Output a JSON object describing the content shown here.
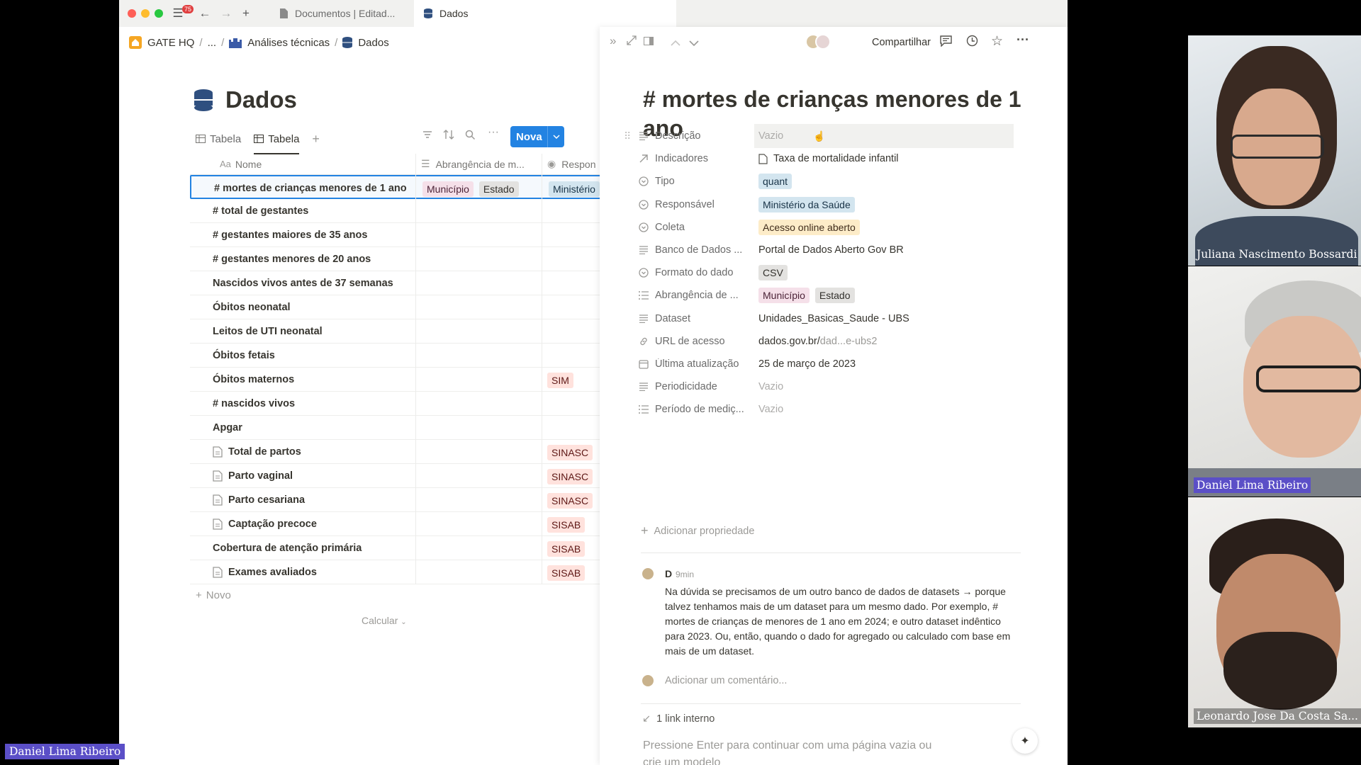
{
  "browser": {
    "badge": "75",
    "tabs": [
      {
        "label": "Documentos | Editad..."
      },
      {
        "label": "Dados"
      }
    ]
  },
  "breadcrumb": [
    "GATE HQ",
    "...",
    "Análises técnicas",
    "Dados"
  ],
  "database": {
    "title": "Dados",
    "views": [
      "Tabela",
      "Tabela"
    ],
    "new_button": "Nova",
    "columns": [
      "Nome",
      "Abrangência de m...",
      "Respon"
    ],
    "rows": [
      {
        "name": "# mortes de crianças menores de 1 ano",
        "doc": false,
        "abr": [
          "Município",
          "Estado"
        ],
        "resp": "Ministério"
      },
      {
        "name": "# total de gestantes",
        "doc": false,
        "abr": [],
        "resp": ""
      },
      {
        "name": "# gestantes maiores de 35 anos",
        "doc": false,
        "abr": [],
        "resp": ""
      },
      {
        "name": "# gestantes menores de 20 anos",
        "doc": false,
        "abr": [],
        "resp": ""
      },
      {
        "name": "Nascidos vivos antes de 37 semanas",
        "doc": false,
        "abr": [],
        "resp": ""
      },
      {
        "name": "Óbitos neonatal",
        "doc": false,
        "abr": [],
        "resp": ""
      },
      {
        "name": "Leitos de UTI neonatal",
        "doc": false,
        "abr": [],
        "resp": ""
      },
      {
        "name": "Óbitos fetais",
        "doc": false,
        "abr": [],
        "resp": ""
      },
      {
        "name": "Óbitos maternos",
        "doc": false,
        "abr": [],
        "resp": "SIM"
      },
      {
        "name": "# nascidos vivos",
        "doc": false,
        "abr": [],
        "resp": ""
      },
      {
        "name": "Apgar",
        "doc": false,
        "abr": [],
        "resp": ""
      },
      {
        "name": "Total de partos",
        "doc": true,
        "abr": [],
        "resp": "SINASC"
      },
      {
        "name": "Parto vaginal",
        "doc": true,
        "abr": [],
        "resp": "SINASC"
      },
      {
        "name": "Parto cesariana",
        "doc": true,
        "abr": [],
        "resp": "SINASC"
      },
      {
        "name": "Captação precoce",
        "doc": true,
        "abr": [],
        "resp": "SISAB"
      },
      {
        "name": "Cobertura de atenção primária",
        "doc": false,
        "abr": [],
        "resp": "SISAB"
      },
      {
        "name": "Exames avaliados",
        "doc": true,
        "abr": [],
        "resp": "SISAB"
      }
    ],
    "add_row": "Novo",
    "calculate": "Calcular"
  },
  "panel": {
    "share": "Compartilhar",
    "title": "# mortes de crianças menores de 1 ano",
    "properties": [
      {
        "label": "Descrição",
        "value": "Vazio",
        "type": "empty",
        "icon": "text-icon"
      },
      {
        "label": "Indicadores",
        "value": "Taxa de mortalidade infantil",
        "type": "relation",
        "icon": "arrow-icon"
      },
      {
        "label": "Tipo",
        "value": "quant",
        "type": "tag-blue",
        "icon": "select-icon"
      },
      {
        "label": "Responsável",
        "value": "Ministério da Saúde",
        "type": "tag-blue",
        "icon": "select-icon"
      },
      {
        "label": "Coleta",
        "value": "Acesso online aberto",
        "type": "tag-yellow",
        "icon": "select-icon"
      },
      {
        "label": "Banco de Dados ...",
        "value": "Portal de Dados Aberto Gov BR",
        "type": "text",
        "icon": "text-icon"
      },
      {
        "label": "Formato do dado",
        "value": "CSV",
        "type": "tag-gray",
        "icon": "select-icon"
      },
      {
        "label": "Abrangência de ...",
        "value": "Município|Estado",
        "type": "multi",
        "icon": "list-icon"
      },
      {
        "label": "Dataset",
        "value": "Unidades_Basicas_Saude - UBS",
        "type": "text",
        "icon": "text-icon"
      },
      {
        "label": "URL de acesso",
        "value": "dados.gov.br/",
        "value2": "dad...e-ubs2",
        "type": "url",
        "icon": "link-icon"
      },
      {
        "label": "Última atualização",
        "value": "25 de março de 2023",
        "type": "text",
        "icon": "calendar-icon"
      },
      {
        "label": "Periodicidade",
        "value": "Vazio",
        "type": "empty",
        "icon": "text-icon"
      },
      {
        "label": "Período de mediç...",
        "value": "Vazio",
        "type": "empty",
        "icon": "list-icon"
      }
    ],
    "add_property": "Adicionar propriedade",
    "comment": {
      "author": "D",
      "time": "9min",
      "text": "Na dúvida se precisamos de um outro banco de dados de datasets → porque talvez tenhamos mais de um dataset para um mesmo dado. Por exemplo, # mortes de crianças de menores de 1 ano em 2024; e outro dataset indêntico para 2023. Ou, então, quando o dado for agregado ou calculado com base em mais de um dataset."
    },
    "comment_placeholder": "Adicionar um comentário...",
    "internal_link": "1 link interno",
    "footer_text": "Pressione Enter para continuar com uma página vazia ou",
    "footer_text2": "crie um modelo"
  },
  "participants": [
    {
      "name": "Juliana Nascimento Bossardi"
    },
    {
      "name": "Daniel Lima Ribeiro"
    },
    {
      "name": "Leonardo Jose Da Costa Sa..."
    }
  ],
  "self_view": {
    "name": "Daniel Lima Ribeiro"
  },
  "colors": {
    "accent": "#2383e2",
    "speaker_label": "#5b4fc7"
  }
}
